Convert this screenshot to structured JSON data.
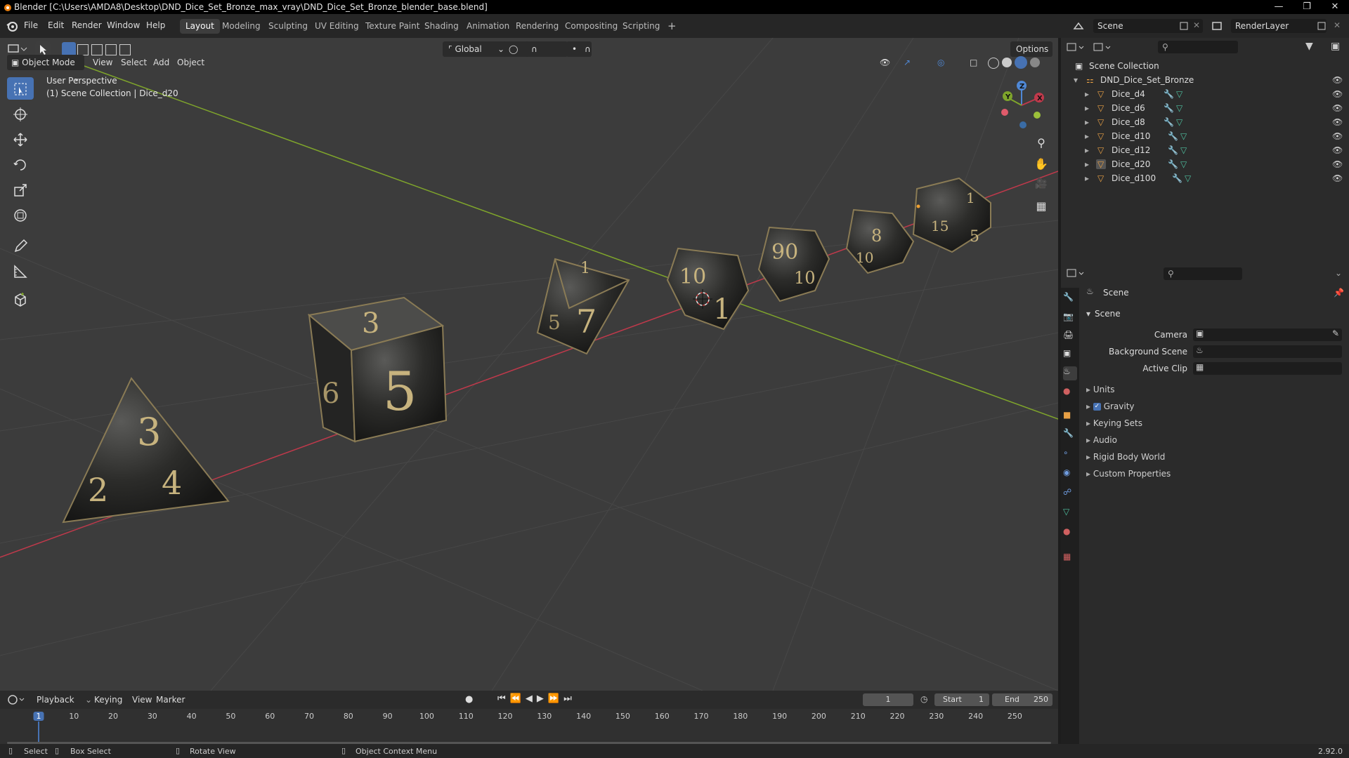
{
  "title": "Blender [C:\\Users\\AMDA8\\Desktop\\DND_Dice_Set_Bronze_max_vray\\DND_Dice_Set_Bronze_blender_base.blend]",
  "menu": [
    "File",
    "Edit",
    "Render",
    "Window",
    "Help"
  ],
  "workspaces": [
    {
      "label": "Layout",
      "active": true
    },
    {
      "label": "Modeling"
    },
    {
      "label": "Sculpting"
    },
    {
      "label": "UV Editing"
    },
    {
      "label": "Texture Paint"
    },
    {
      "label": "Shading"
    },
    {
      "label": "Animation"
    },
    {
      "label": "Rendering"
    },
    {
      "label": "Compositing"
    },
    {
      "label": "Scripting"
    }
  ],
  "scene_field": "Scene",
  "renderlayer_field": "RenderLayer",
  "viewport": {
    "mode": "Object Mode",
    "menus": [
      "View",
      "Select",
      "Add",
      "Object"
    ],
    "transform": "Global",
    "options": "Options",
    "overlay_line1": "User Perspective",
    "overlay_line2": "(1) Scene Collection | Dice_d20",
    "gizmo": {
      "x": "X",
      "y": "Y",
      "z": "Z"
    },
    "dice_faces": {
      "d4": [
        "3",
        "2",
        "4"
      ],
      "d6": [
        "3",
        "6",
        "5"
      ],
      "d8": [
        "1",
        "7",
        "5"
      ],
      "d10": [
        "10",
        "1"
      ],
      "d12": [
        "90",
        "10"
      ],
      "d20": [
        "8",
        "10"
      ],
      "d100": [
        "1",
        "15",
        "5"
      ]
    }
  },
  "outliner": {
    "root": "Scene Collection",
    "collection": "DND_Dice_Set_Bronze",
    "items": [
      "Dice_d4",
      "Dice_d6",
      "Dice_d8",
      "Dice_d10",
      "Dice_d12",
      "Dice_d20",
      "Dice_d100"
    ]
  },
  "properties": {
    "breadcrumb": "Scene",
    "section": "Scene",
    "fields": [
      {
        "label": "Camera"
      },
      {
        "label": "Background Scene"
      },
      {
        "label": "Active Clip"
      }
    ],
    "panels": [
      "Units",
      "Gravity",
      "Keying Sets",
      "Audio",
      "Rigid Body World",
      "Custom Properties"
    ],
    "gravity_checked": true
  },
  "timeline": {
    "menus": [
      "Playback",
      "Keying",
      "View",
      "Marker"
    ],
    "current_frame": "1",
    "start_label": "Start",
    "start": "1",
    "end_label": "End",
    "end": "250",
    "ticks": [
      "1",
      "10",
      "20",
      "30",
      "40",
      "50",
      "60",
      "70",
      "80",
      "90",
      "100",
      "110",
      "120",
      "130",
      "140",
      "150",
      "160",
      "170",
      "180",
      "190",
      "200",
      "210",
      "220",
      "230",
      "240",
      "250"
    ]
  },
  "status": {
    "select": "Select",
    "box_select": "Box Select",
    "rotate_view": "Rotate View",
    "context_menu": "Object Context Menu",
    "version": "2.92.0"
  },
  "colors": {
    "accent": "#4772b3",
    "x_axis": "#c0394b",
    "y_axis": "#7fa52b",
    "viewport_bg": "#3c3c3c",
    "dice": "#2c2c2a",
    "numbers": "#c7b37e"
  }
}
